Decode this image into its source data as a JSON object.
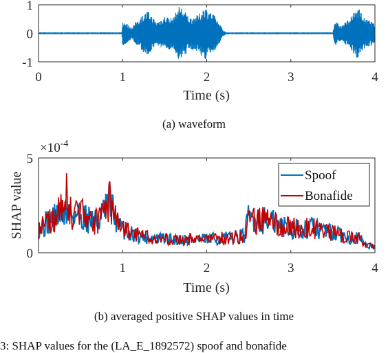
{
  "chart_data": [
    {
      "type": "line",
      "title": "",
      "caption": "(a) waveform",
      "xlabel": "Time (s)",
      "ylabel": "",
      "xlim": [
        0,
        4
      ],
      "ylim": [
        -1,
        1
      ],
      "xticks": [
        "0",
        "1",
        "2",
        "3",
        "4"
      ],
      "yticks": [
        "1",
        "0",
        "-1"
      ],
      "grid": false,
      "series": [
        {
          "name": "waveform",
          "color": "#0072BD",
          "envelope": [
            {
              "t": 0.0,
              "amp": 0.01
            },
            {
              "t": 0.99,
              "amp": 0.01
            },
            {
              "t": 1.0,
              "amp": 0.45
            },
            {
              "t": 1.05,
              "amp": 0.35
            },
            {
              "t": 1.1,
              "amp": 0.2
            },
            {
              "t": 1.2,
              "amp": 0.55
            },
            {
              "t": 1.3,
              "amp": 0.8
            },
            {
              "t": 1.4,
              "amp": 0.4
            },
            {
              "t": 1.5,
              "amp": 0.6
            },
            {
              "t": 1.6,
              "amp": 0.55
            },
            {
              "t": 1.68,
              "amp": 1.0
            },
            {
              "t": 1.8,
              "amp": 0.55
            },
            {
              "t": 1.9,
              "amp": 0.65
            },
            {
              "t": 1.98,
              "amp": 0.95
            },
            {
              "t": 2.1,
              "amp": 0.6
            },
            {
              "t": 2.2,
              "amp": 0.1
            },
            {
              "t": 2.25,
              "amp": 0.01
            },
            {
              "t": 3.5,
              "amp": 0.01
            },
            {
              "t": 3.52,
              "amp": 0.45
            },
            {
              "t": 3.6,
              "amp": 0.25
            },
            {
              "t": 3.72,
              "amp": 0.6
            },
            {
              "t": 3.8,
              "amp": 0.95
            },
            {
              "t": 3.88,
              "amp": 0.5
            },
            {
              "t": 3.95,
              "amp": 0.45
            },
            {
              "t": 4.0,
              "amp": 0.3
            }
          ]
        }
      ]
    },
    {
      "type": "line",
      "title": "",
      "caption": "(b) averaged positive SHAP values in time",
      "xlabel": "Time (s)",
      "ylabel": "SHAP value",
      "exponent_label": "×10",
      "exponent_power": "-4",
      "xlim": [
        0,
        4
      ],
      "ylim": [
        0,
        5
      ],
      "y_scale": 0.0001,
      "xticks": [
        "1",
        "2",
        "3",
        "4"
      ],
      "yticks": [
        "5",
        "0"
      ],
      "grid": false,
      "legend": {
        "position": "top-right",
        "entries": [
          "Spoof",
          "Bonafide"
        ]
      },
      "series": [
        {
          "name": "Spoof",
          "color": "#0072BD",
          "trend": [
            {
              "t": 0.0,
              "v": 1.3
            },
            {
              "t": 0.15,
              "v": 1.7
            },
            {
              "t": 0.3,
              "v": 2.2
            },
            {
              "t": 0.5,
              "v": 2.0
            },
            {
              "t": 0.7,
              "v": 1.6
            },
            {
              "t": 0.85,
              "v": 2.6
            },
            {
              "t": 0.95,
              "v": 1.4
            },
            {
              "t": 1.1,
              "v": 1.0
            },
            {
              "t": 1.3,
              "v": 0.8
            },
            {
              "t": 1.6,
              "v": 0.7
            },
            {
              "t": 2.0,
              "v": 0.7
            },
            {
              "t": 2.3,
              "v": 0.8
            },
            {
              "t": 2.45,
              "v": 0.9
            },
            {
              "t": 2.5,
              "v": 1.9
            },
            {
              "t": 2.7,
              "v": 1.7
            },
            {
              "t": 3.0,
              "v": 1.3
            },
            {
              "t": 3.3,
              "v": 1.3
            },
            {
              "t": 3.6,
              "v": 0.9
            },
            {
              "t": 3.8,
              "v": 0.8
            },
            {
              "t": 3.9,
              "v": 0.4
            },
            {
              "t": 4.0,
              "v": 0.3
            }
          ]
        },
        {
          "name": "Bonafide",
          "color": "#C00000",
          "trend": [
            {
              "t": 0.0,
              "v": 1.3
            },
            {
              "t": 0.15,
              "v": 1.7
            },
            {
              "t": 0.3,
              "v": 2.3
            },
            {
              "t": 0.5,
              "v": 2.0
            },
            {
              "t": 0.7,
              "v": 1.6
            },
            {
              "t": 0.86,
              "v": 2.7
            },
            {
              "t": 0.95,
              "v": 1.4
            },
            {
              "t": 1.1,
              "v": 1.0
            },
            {
              "t": 1.3,
              "v": 0.8
            },
            {
              "t": 1.6,
              "v": 0.7
            },
            {
              "t": 2.0,
              "v": 0.7
            },
            {
              "t": 2.3,
              "v": 0.8
            },
            {
              "t": 2.45,
              "v": 0.9
            },
            {
              "t": 2.5,
              "v": 1.6
            },
            {
              "t": 2.7,
              "v": 1.7
            },
            {
              "t": 3.0,
              "v": 1.3
            },
            {
              "t": 3.3,
              "v": 1.3
            },
            {
              "t": 3.6,
              "v": 0.9
            },
            {
              "t": 3.8,
              "v": 0.8
            },
            {
              "t": 3.9,
              "v": 0.4
            },
            {
              "t": 4.0,
              "v": 0.3
            }
          ],
          "peak_annotations": [
            {
              "t": 0.33,
              "v": 4.2
            },
            {
              "t": 0.86,
              "v": 3.1
            },
            {
              "t": 2.5,
              "v": 2.2
            }
          ]
        }
      ]
    }
  ],
  "figure_caption_partial": "3: SHAP values for the (LA_E_1892572) spoof and bonafide"
}
